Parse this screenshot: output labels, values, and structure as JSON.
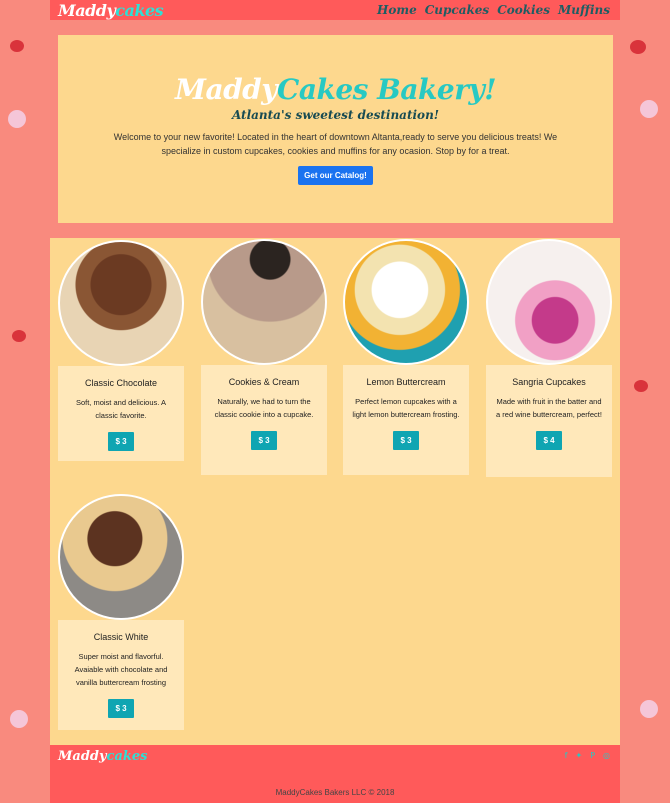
{
  "nav": {
    "brand_main": "Maddy",
    "brand_accent": "cakes",
    "links": [
      "Home",
      "Cupcakes",
      "Cookies",
      "Muffins"
    ]
  },
  "hero": {
    "title_main": "Maddy",
    "title_accent": "Cakes Bakery!",
    "subtitle": "Atlanta's sweetest destination!",
    "description": "Welcome to your new favorite! Located in the heart of downtown Altanta,ready to serve you delicious treats! We specialize in custom cupcakes, cookies and muffins for any ocasion. Stop by for a treat.",
    "cta_label": "Get our Catalog!"
  },
  "products": [
    {
      "name": "Classic Chocolate",
      "desc": "Soft, moist and delicious. A classic favorite.",
      "price": "$ 3"
    },
    {
      "name": "Cookies & Cream",
      "desc": "Naturally, we had to turn the classic cookie into a cupcake.",
      "price": "$ 3"
    },
    {
      "name": "Lemon Buttercream",
      "desc": "Perfect lemon cupcakes with a light lemon buttercream frosting.",
      "price": "$ 3"
    },
    {
      "name": "Sangria Cupcakes",
      "desc": "Made with fruit in the batter and a red wine buttercream, perfect!",
      "price": "$ 4"
    },
    {
      "name": "Classic White",
      "desc": "Super moist and flavorful. Avaiable with chocolate and vanilla buttercream frosting",
      "price": "$ 3"
    }
  ],
  "footer": {
    "brand_main": "Maddy",
    "brand_accent": "cakes",
    "copyright": "MaddyCakes Bakers LLC © 2018",
    "social_icons": [
      "facebook-icon",
      "twitter-icon",
      "pinterest-icon",
      "instagram-icon"
    ]
  },
  "colors": {
    "accent": "#ff5a5a",
    "teal": "#27c9c3",
    "panel": "#fdd88e"
  }
}
